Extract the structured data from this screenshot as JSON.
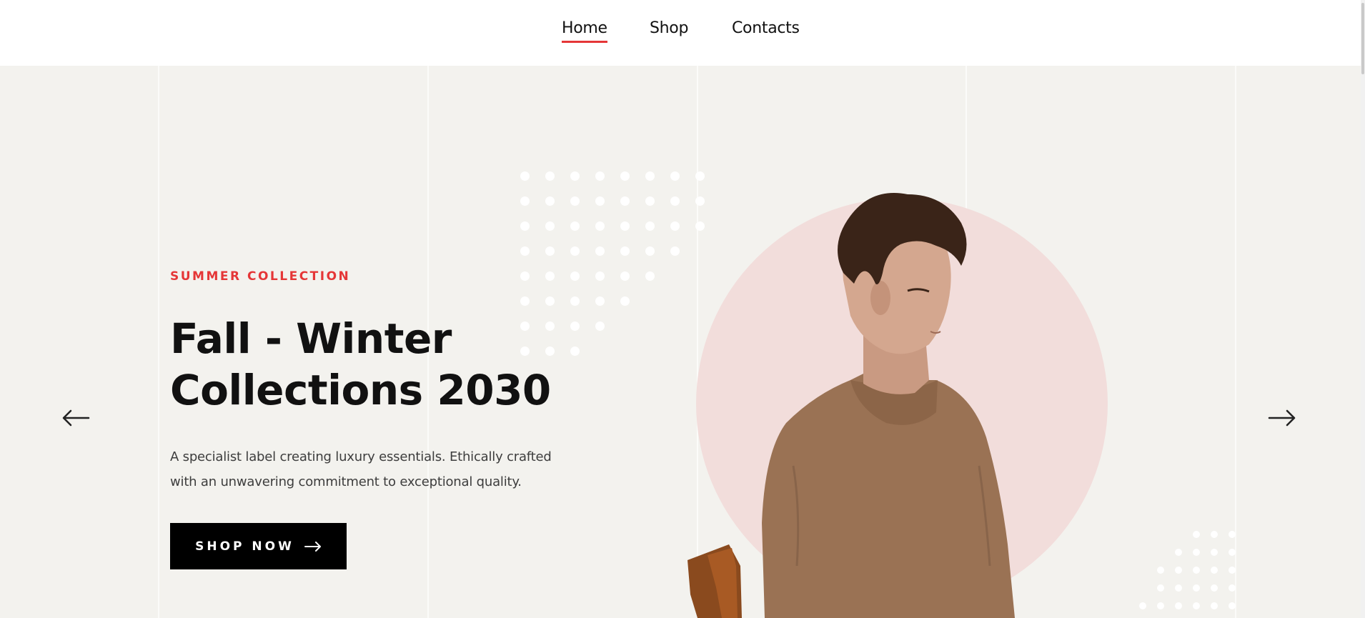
{
  "nav": {
    "items": [
      {
        "label": "Home",
        "active": true
      },
      {
        "label": "Shop",
        "active": false
      },
      {
        "label": "Contacts",
        "active": false
      }
    ]
  },
  "hero": {
    "subtitle": "SUMMER COLLECTION",
    "title_line1": "Fall - Winter",
    "title_line2": "Collections 2030",
    "description_line1": "A specialist label creating luxury essentials. Ethically crafted",
    "description_line2": "with an unwavering commitment to exceptional quality.",
    "button_label": "SHOP NOW",
    "button_icon": "arrow-right-icon",
    "prev_icon": "arrow-left-icon",
    "next_icon": "arrow-right-icon",
    "image": "model-in-brown-turtleneck"
  },
  "colors": {
    "accent": "#e53637",
    "hero_bg": "#f3f2ee",
    "circle": "#f2dddb",
    "button_bg": "#000000",
    "sweater": "#9a7254"
  }
}
